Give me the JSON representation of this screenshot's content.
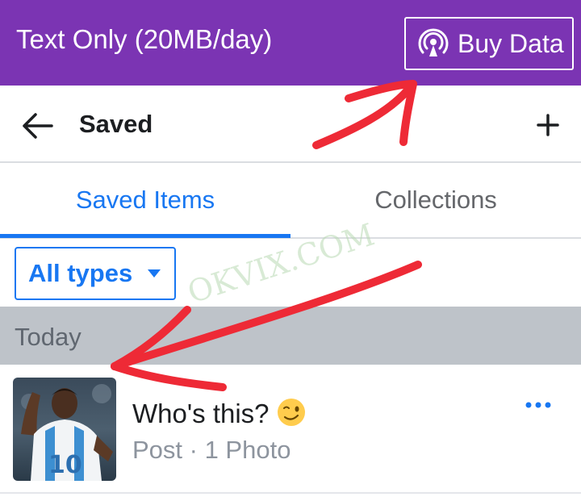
{
  "status_bar": {
    "plan_text": "Text Only (20MB/day)",
    "buy_label": "Buy Data",
    "buy_icon": "broadcast-icon",
    "color": "#7b34b3"
  },
  "header": {
    "back_icon": "arrow-left-icon",
    "title": "Saved",
    "add_icon": "plus-icon"
  },
  "tabs": [
    {
      "label": "Saved Items",
      "active": true
    },
    {
      "label": "Collections",
      "active": false
    }
  ],
  "filter": {
    "label": "All types",
    "icon": "caret-down-icon"
  },
  "section": {
    "label": "Today"
  },
  "items": [
    {
      "title": "Who's this?",
      "emoji": "winking-face-emoji",
      "subtitle": "Post · 1 Photo",
      "menu_icon": "more-horizontal-icon"
    }
  ],
  "watermark": "OKVIX.COM",
  "accent_color": "#1877f2",
  "annotation_color": "#ee2a36"
}
